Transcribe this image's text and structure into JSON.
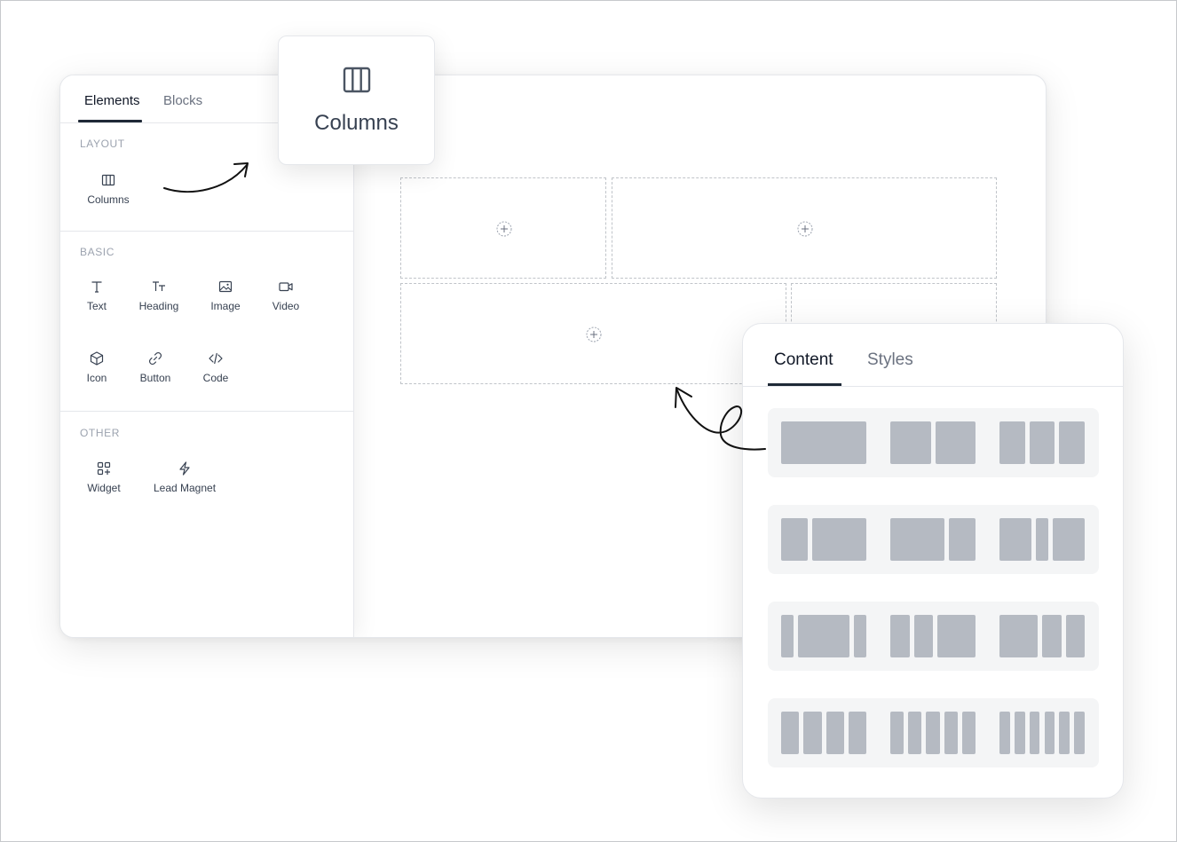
{
  "sidebar": {
    "tabs": [
      {
        "label": "Elements",
        "active": true
      },
      {
        "label": "Blocks",
        "active": false
      }
    ],
    "sections": {
      "layout": {
        "title": "LAYOUT",
        "items": [
          {
            "label": "Columns",
            "icon": "columns-icon"
          }
        ]
      },
      "basic": {
        "title": "BASIC",
        "items": [
          {
            "label": "Text",
            "icon": "text-icon"
          },
          {
            "label": "Heading",
            "icon": "heading-icon"
          },
          {
            "label": "Image",
            "icon": "image-icon"
          },
          {
            "label": "Video",
            "icon": "video-icon"
          },
          {
            "label": "Icon",
            "icon": "cube-icon"
          },
          {
            "label": "Button",
            "icon": "link-icon"
          },
          {
            "label": "Code",
            "icon": "code-icon"
          }
        ]
      },
      "other": {
        "title": "OTHER",
        "items": [
          {
            "label": "Widget",
            "icon": "widget-icon"
          },
          {
            "label": "Lead Magnet",
            "icon": "lightning-icon"
          }
        ]
      }
    }
  },
  "tooltip": {
    "label": "Columns",
    "icon": "columns-icon"
  },
  "panel": {
    "tabs": [
      {
        "label": "Content",
        "active": true
      },
      {
        "label": "Styles",
        "active": false
      }
    ],
    "presets": [
      [
        [
          1
        ],
        [
          1,
          1
        ],
        [
          1,
          1,
          1
        ]
      ],
      [
        [
          1,
          2
        ],
        [
          2,
          1
        ],
        [
          1,
          0.4,
          1
        ]
      ],
      [
        [
          1,
          4,
          1
        ],
        [
          1,
          1,
          2
        ],
        [
          2,
          1,
          1
        ]
      ],
      [
        [
          1,
          1,
          1,
          1
        ],
        [
          1,
          1,
          1,
          1,
          1
        ],
        [
          1,
          1,
          1,
          1,
          1,
          1
        ]
      ]
    ]
  },
  "colors": {
    "accent": "#1f2937",
    "preset_column": "#b5bac2",
    "preset_row_bg": "#f4f5f6"
  }
}
